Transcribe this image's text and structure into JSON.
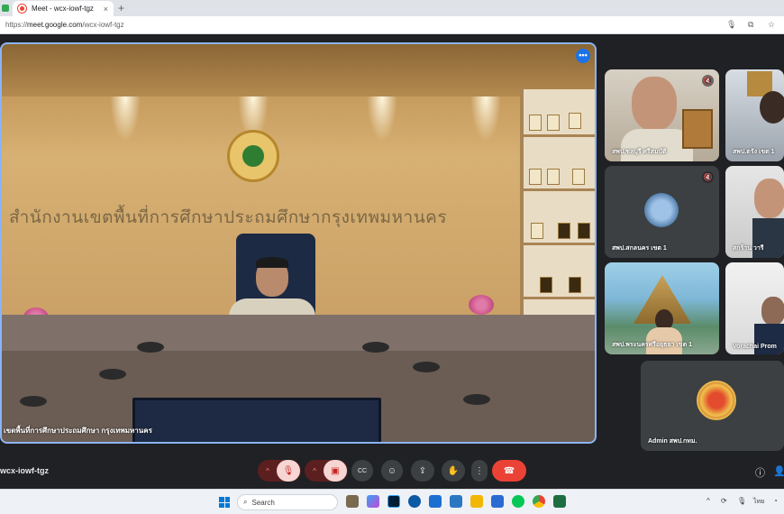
{
  "browser": {
    "tab_title": "Meet - wcx-iowf-tgz",
    "tab_close": "×",
    "new_tab": "+",
    "url_scheme": "https://",
    "url_host": "meet.google.com",
    "url_path": "/wcx-iowf-tgz"
  },
  "main_tile": {
    "wall_text": "สำนักงานเขตพื้นที่การศึกษาประถมศึกษากรุงเทพมหานคร",
    "name_label": "เขตพื้นที่การศึกษาประถมศึกษา กรุงเทพมหานคร",
    "more_glyph": "•••"
  },
  "participants": [
    {
      "label": "สพป.ชลบุรี ศรีสมบัติ"
    },
    {
      "label": "สพป.ตรัง เขต 1"
    },
    {
      "label": "สพป.สกลนคร เขต 1"
    },
    {
      "label": "สกร้าน วารี"
    },
    {
      "label": "สพป.พระนครศรีอยุธยา เขต 1"
    },
    {
      "label": "Vorachai Prom"
    },
    {
      "label": "Admin สพป.กทม."
    }
  ],
  "controls": {
    "meeting_code": "wcx-iowf-tgz",
    "mic_caret": "^",
    "cam_caret": "^",
    "mic_off_icon_glyph": "🎙",
    "cam_off_icon_glyph": "▣",
    "cc_glyph": "CC",
    "emoji_glyph": "☺",
    "present_glyph": "⇪",
    "hand_glyph": "✋",
    "more_glyph": "⋮",
    "end_call_glyph": "☎",
    "info_glyph": "ⓘ",
    "people_glyph": "👤"
  },
  "taskbar": {
    "search_placeholder": "Search",
    "tray_lang": "ไทย"
  },
  "colors": {
    "accent_blue": "#8ab4f8",
    "end_call_red": "#ea4335",
    "meet_bg": "#202124"
  }
}
